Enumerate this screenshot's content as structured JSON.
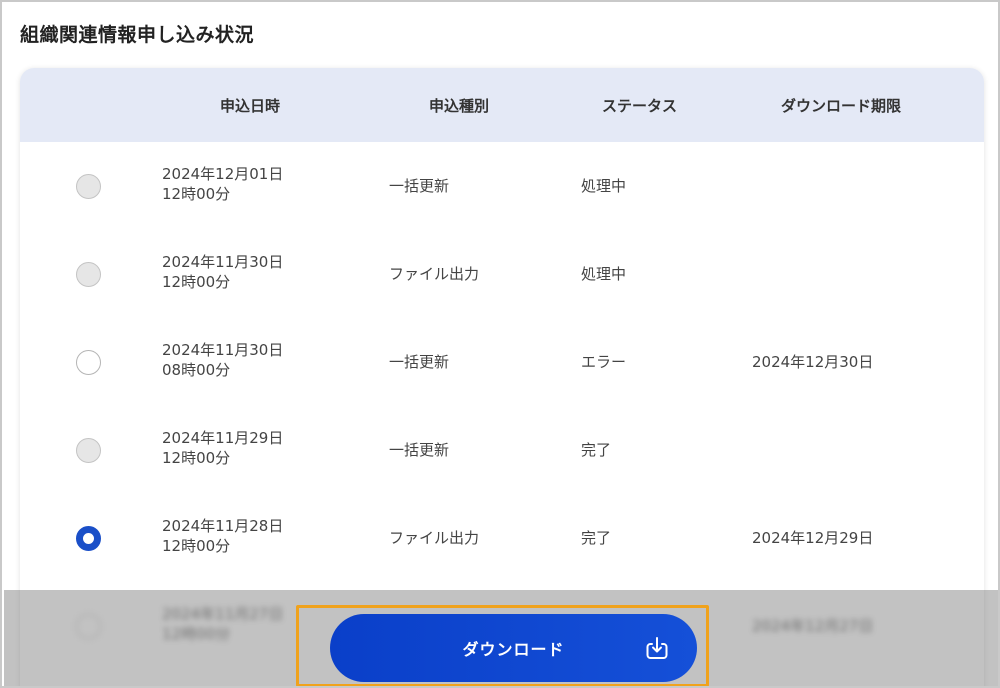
{
  "page": {
    "title": "組織関連情報申し込み状況"
  },
  "table": {
    "headers": [
      "申込日時",
      "申込種別",
      "ステータス",
      "ダウンロード期限"
    ],
    "rows": [
      {
        "date_line1": "2024年12月01日",
        "date_line2": "12時00分",
        "type": "一括更新",
        "status": "処理中",
        "deadline": "",
        "radio": "disabled"
      },
      {
        "date_line1": "2024年11月30日",
        "date_line2": "12時00分",
        "type": "ファイル出力",
        "status": "処理中",
        "deadline": "",
        "radio": "disabled"
      },
      {
        "date_line1": "2024年11月30日",
        "date_line2": "08時00分",
        "type": "一括更新",
        "status": "エラー",
        "deadline": "2024年12月30日",
        "radio": "enabled"
      },
      {
        "date_line1": "2024年11月29日",
        "date_line2": "12時00分",
        "type": "一括更新",
        "status": "完了",
        "deadline": "",
        "radio": "disabled"
      },
      {
        "date_line1": "2024年11月28日",
        "date_line2": "12時00分",
        "type": "ファイル出力",
        "status": "完了",
        "deadline": "2024年12月29日",
        "radio": "selected"
      },
      {
        "date_line1": "2024年11月27日",
        "date_line2": "12時00分",
        "type": "",
        "status": "",
        "deadline": "2024年12月27日",
        "radio": "enabled"
      }
    ]
  },
  "download": {
    "label": "ダウンロード",
    "icon": "download-icon"
  },
  "colors": {
    "accent": "#1a4fc8",
    "header_bg": "#e4e9f6",
    "highlight": "#f0a21c"
  }
}
